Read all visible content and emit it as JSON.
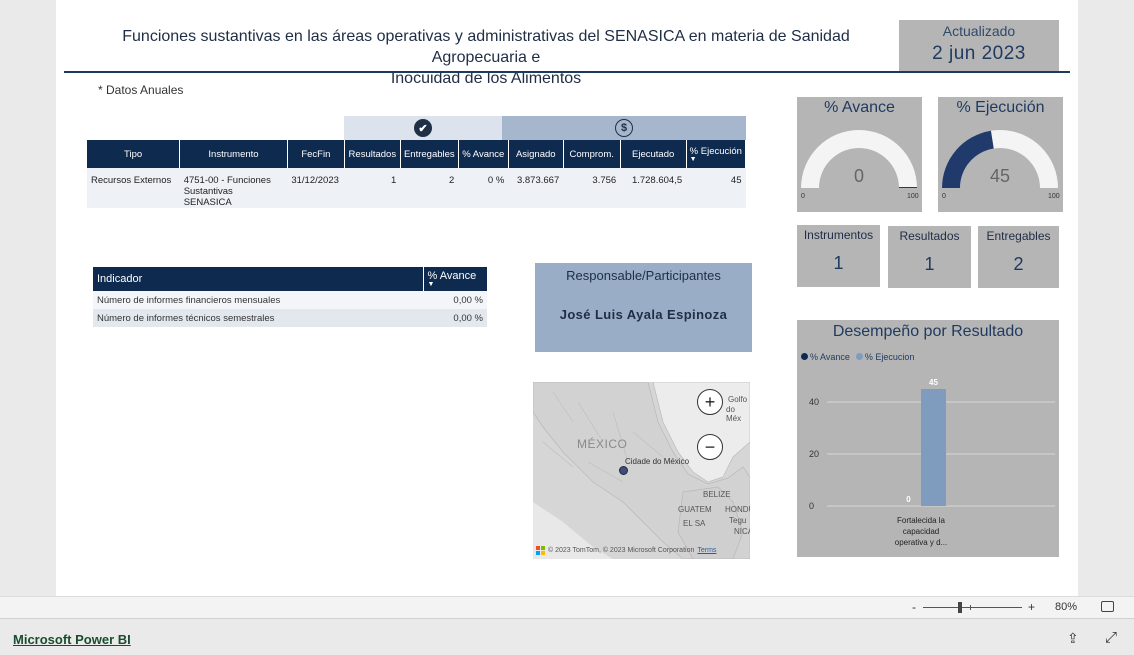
{
  "header": {
    "title_line1": "Funciones sustantivas en las áreas operativas y administrativas del SENASICA en materia de Sanidad Agropecuaria e",
    "title_line2": "Inocuidad de los Alimentos",
    "updated_label": "Actualizado",
    "updated_date": "2 jun 2023",
    "annual_note": "* Datos Anuales"
  },
  "main_table": {
    "columns": [
      "Tipo",
      "Instrumento",
      "FecFin",
      "Resultados",
      "Entregables",
      "% Avance",
      "Asignado",
      "Comprom.",
      "Ejecutado",
      "% Ejecución"
    ],
    "row": {
      "tipo": "Recursos Externos",
      "instrumento": "4751-00 - Funciones Sustantivas SENASICA",
      "fecfin": "31/12/2023",
      "resultados": "1",
      "entregables": "2",
      "avance": "0 %",
      "asignado": "3.873.667",
      "comprom": "3.756",
      "ejecutado": "1.728.604,5",
      "ejecucion": "45"
    }
  },
  "indicator_table": {
    "col_indicador": "Indicador",
    "col_avance": "% Avance",
    "rows": [
      {
        "indicador": "Número de informes financieros mensuales",
        "avance": "0,00 %"
      },
      {
        "indicador": "Número de informes técnicos semestrales",
        "avance": "0,00 %"
      }
    ]
  },
  "responsible": {
    "title": "Responsable/Participantes",
    "name": "José Luis Ayala Espinoza"
  },
  "map": {
    "label_country": "MÉXICO",
    "label_city": "Cidade do México",
    "label_gulf1": "Golfo",
    "label_gulf2": "do Méx",
    "label_belize": "BELIZE",
    "label_guate": "GUATEM",
    "label_honduras": "HONDU",
    "label_salvador": "EL SA",
    "label_tegu": "Tegu",
    "label_nica": "NICA",
    "attribution": "© 2023 TomTom, © 2023 Microsoft Corporation",
    "terms": "Terms",
    "ms_logo": "Microsoft"
  },
  "gauge_avance": {
    "title": "% Avance",
    "value": "0",
    "value_num": 0,
    "min": "0",
    "max": "100"
  },
  "gauge_ejecucion": {
    "title": "% Ejecución",
    "value": "45",
    "value_num": 45,
    "min": "0",
    "max": "100"
  },
  "cards": {
    "instrumentos_label": "Instrumentos",
    "instrumentos_value": "1",
    "resultados_label": "Resultados",
    "resultados_value": "1",
    "entregables_label": "Entregables",
    "entregables_value": "2"
  },
  "chart_data": {
    "type": "bar",
    "title": "Desempeño por Resultado",
    "categories": [
      "Fortalecida la capacidad operativa y d..."
    ],
    "category_lines": [
      "Fortalecida la",
      "capacidad",
      "operativa y d..."
    ],
    "series": [
      {
        "name": "% Avance",
        "values": [
          0
        ],
        "color": "#0e2a4f"
      },
      {
        "name": "% Ejecucion",
        "values": [
          45
        ],
        "color": "#7f9bbd"
      }
    ],
    "yticks": [
      "0",
      "20",
      "40"
    ],
    "ylim": [
      0,
      50
    ],
    "grid": true,
    "legend": "top-left"
  },
  "footer": {
    "zoom_minus": "-",
    "zoom_plus": "+",
    "zoom_level": "80%",
    "powerbi_link": "Microsoft Power BI"
  },
  "colors": {
    "navy": "#0e2a4f",
    "gauge_fill": "#1f3a6b",
    "card_gray": "#b5b5b5",
    "resp_blue": "#99aec6"
  }
}
